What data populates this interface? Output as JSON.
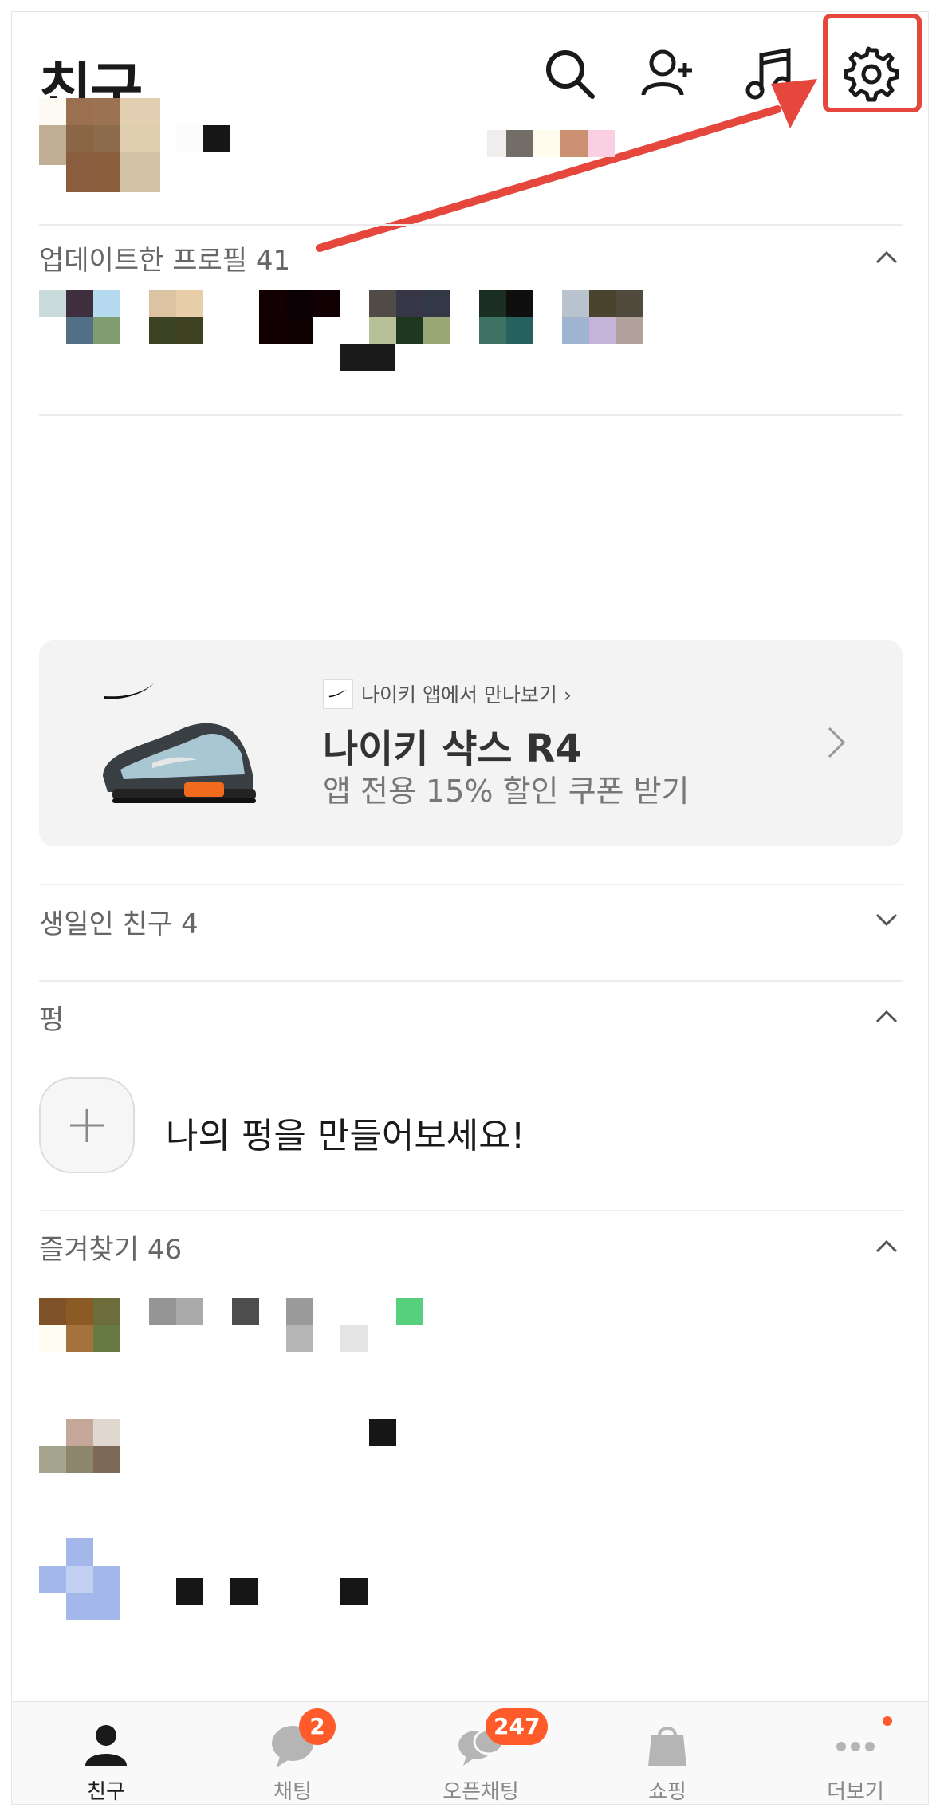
{
  "header": {
    "title": "친구"
  },
  "sections": {
    "updated_profiles": "업데이트한 프로필 41",
    "birthday": "생일인 친구 4",
    "pung": "펑",
    "favorites": "즐겨찾기 46"
  },
  "ad": {
    "small_text": "나이키 앱에서 만나보기 ›",
    "title": "나이키 샥스 R4",
    "subtitle": "앱 전용 15% 할인 쿠폰 받기"
  },
  "pung": {
    "prompt": "나의 펑을 만들어보세요!"
  },
  "tabs": [
    {
      "label": "친구",
      "badge": ""
    },
    {
      "label": "채팅",
      "badge": "2"
    },
    {
      "label": "오픈채팅",
      "badge": "247"
    },
    {
      "label": "쇼핑",
      "badge": ""
    },
    {
      "label": "더보기",
      "badge": ""
    }
  ],
  "colors": {
    "accent": "#ff5a29",
    "annotation": "#e5473d"
  }
}
